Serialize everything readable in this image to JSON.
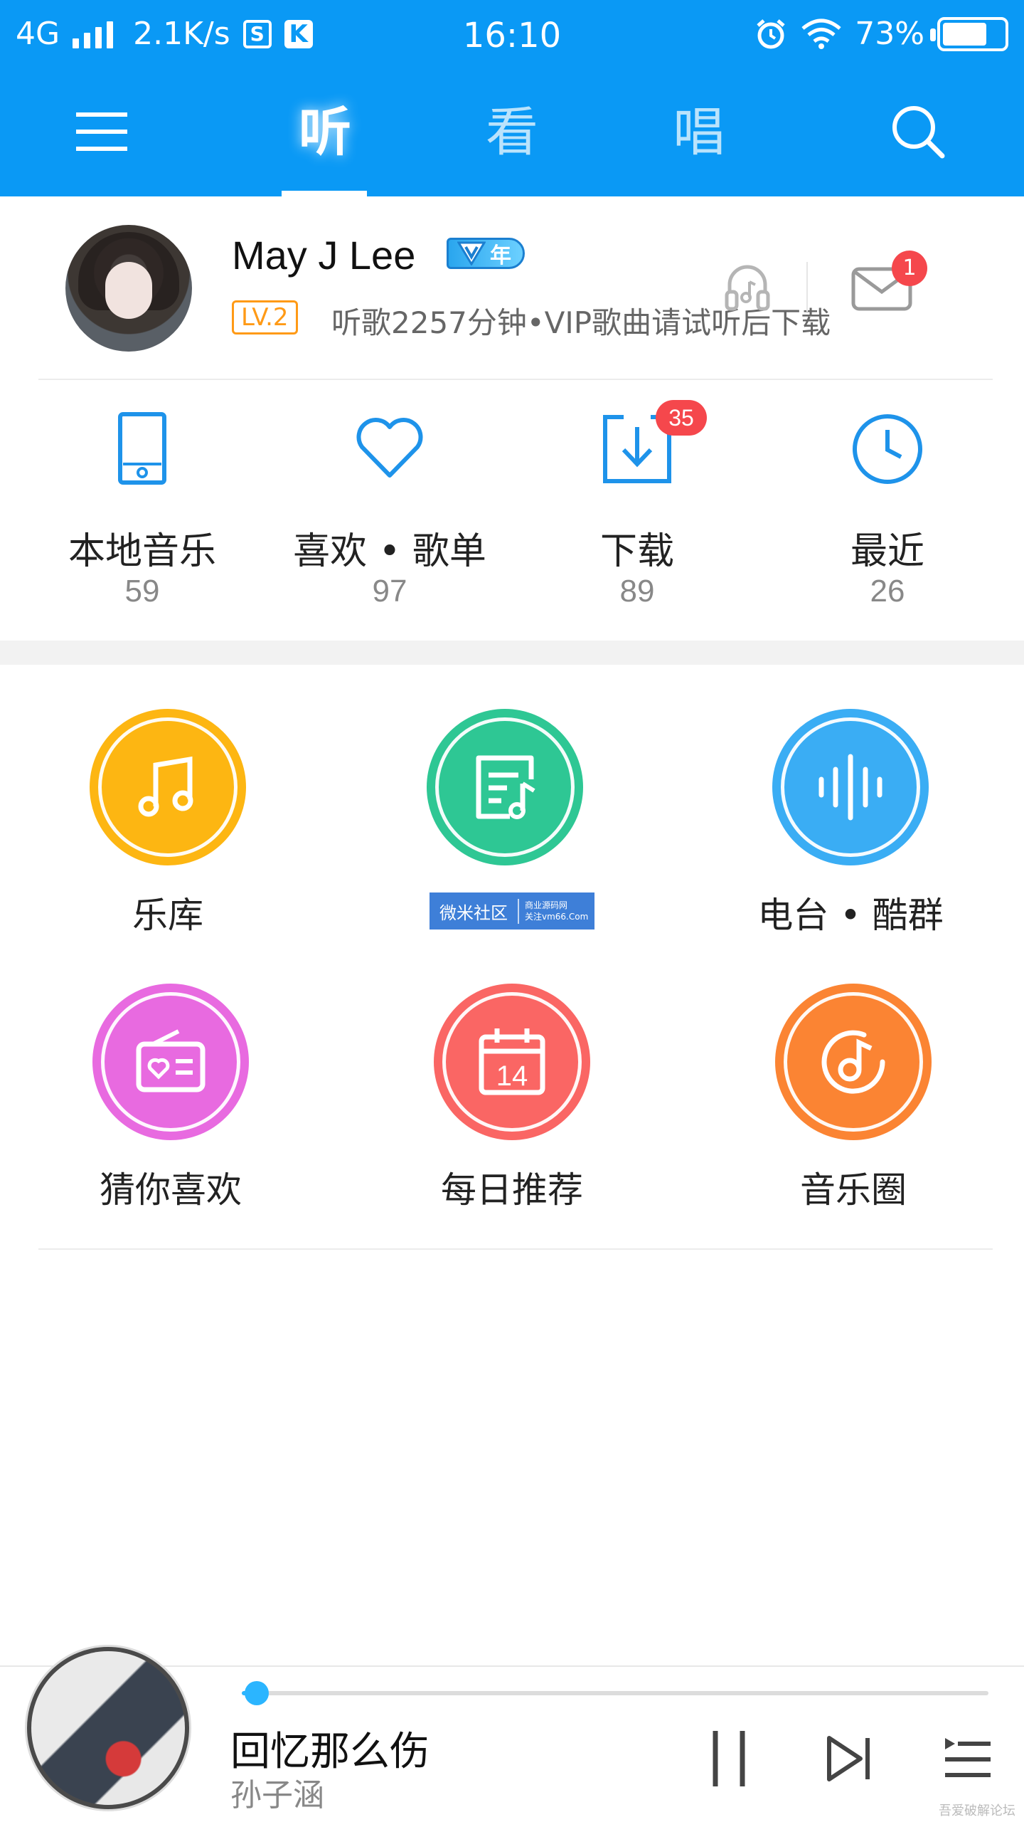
{
  "status_bar": {
    "network": "4G",
    "speed": "2.1K/s",
    "s_icon": "S",
    "k_icon": "K",
    "time": "16:10",
    "battery": "73%",
    "battery_level": 0.73
  },
  "nav": {
    "tabs": [
      {
        "label": "听",
        "active": true
      },
      {
        "label": "看",
        "active": false
      },
      {
        "label": "唱",
        "active": false
      }
    ],
    "icons": [
      "menu-icon",
      "search-icon"
    ]
  },
  "profile": {
    "name": "May J Lee",
    "vip_badge": "年",
    "level": "LV.2",
    "subtitle": "听歌2257分钟•VIP歌曲请试听后下载",
    "mail_badge": "1"
  },
  "stats": [
    {
      "label": "本地音乐",
      "count": "59",
      "icon": "tablet-icon"
    },
    {
      "label": "喜欢 • 歌单",
      "count": "97",
      "icon": "heart-icon"
    },
    {
      "label": "下载",
      "count": "89",
      "icon": "download-icon",
      "badge": "35"
    },
    {
      "label": "最近",
      "count": "26",
      "icon": "clock-icon"
    }
  ],
  "grid": [
    {
      "label": "乐库",
      "color": "#fdb612",
      "icon": "music-note-icon"
    },
    {
      "label": "",
      "color": "#2ec794",
      "icon": "playlist-icon"
    },
    {
      "label": "电台 • 酷群",
      "color": "#3aadf4",
      "icon": "soundwave-icon"
    },
    {
      "label": "猜你喜欢",
      "color": "#e86ae0",
      "icon": "radio-heart-icon"
    },
    {
      "label": "每日推荐",
      "color": "#fa6664",
      "icon": "calendar-icon",
      "day": "14"
    },
    {
      "label": "音乐圈",
      "color": "#fb8433",
      "icon": "music-circle-icon"
    }
  ],
  "watermark": {
    "main": "微米社区",
    "line1": "商业源码网",
    "line2": "关注vm66.Com"
  },
  "player": {
    "title": "回忆那么伤",
    "artist": "孙子涵",
    "progress": 0.02
  },
  "footer_mark": "吾爱破解论坛"
}
